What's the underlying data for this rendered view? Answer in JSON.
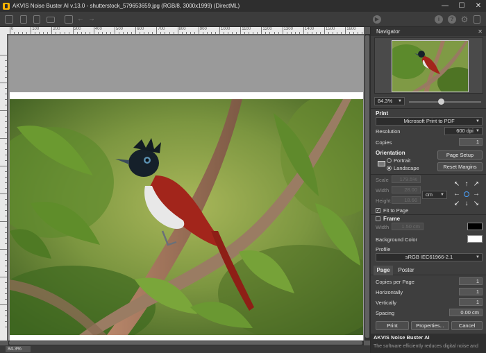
{
  "window": {
    "title": "AKVIS Noise Buster AI v.13.0 - shutterstock_579653659.jpg (RGB/8, 3000x1999) (DirectML)",
    "minimize": "—",
    "maximize": "☐",
    "close": "✕"
  },
  "toolbar": {
    "icons": [
      "open-icon",
      "save-icon",
      "batch-icon",
      "print-icon",
      "screen-icon",
      "undo-icon",
      "redo-icon",
      "run-icon",
      "info-icon",
      "help-icon",
      "settings-icon",
      "share-icon"
    ]
  },
  "ruler": {
    "top_labels": [
      "0",
      "100",
      "200",
      "300",
      "400",
      "500",
      "600",
      "700",
      "800",
      "900",
      "1000",
      "1100",
      "1200",
      "1300",
      "1400",
      "1500",
      "1600"
    ],
    "left_labels": [
      "100",
      "200",
      "300",
      "400",
      "500",
      "600",
      "700",
      "800",
      "900",
      "1000"
    ]
  },
  "status": {
    "zoom": "84.3%"
  },
  "navigator": {
    "title": "Navigator",
    "close": "✕",
    "zoom": "84.3%",
    "zoom_slider": 0.45
  },
  "print": {
    "heading": "Print",
    "printer": "Microsoft Print to PDF",
    "resolution_label": "Resolution",
    "resolution": "600 dpi",
    "copies_label": "Copies",
    "copies": "1",
    "orientation_label": "Orientation",
    "portrait": "Portrait",
    "landscape": "Landscape",
    "orientation_selected": "Landscape",
    "page_setup": "Page Setup",
    "reset_margins": "Reset Margins",
    "scale_label": "Scale",
    "scale": "179.5%",
    "width_label": "Width",
    "width": "28.00",
    "height_label": "Height",
    "height": "18.66",
    "unit": "cm",
    "fit_to_page": "Fit to Page",
    "fit_checked": true,
    "frame_label": "Frame",
    "frame_checked": false,
    "frame_width_label": "Width",
    "frame_width": "1.50 cm",
    "frame_color": "#000000",
    "background_color_label": "Background Color",
    "background_color": "#ffffff",
    "profile_label": "Profile",
    "profile": "sRGB IEC61966-2.1"
  },
  "tabs": {
    "page": "Page",
    "poster": "Poster",
    "active": "Page"
  },
  "page": {
    "copies_per_page_label": "Copies per Page",
    "copies_per_page": "1",
    "horizontally_label": "Horizontally",
    "horizontally": "1",
    "vertically_label": "Vertically",
    "vertically": "1",
    "spacing_label": "Spacing",
    "spacing": "0.00 cm"
  },
  "actions": {
    "print": "Print",
    "properties": "Properties...",
    "cancel": "Cancel"
  },
  "info": {
    "title": "AKVIS Noise Buster AI",
    "text": "The software efficiently reduces digital noise and"
  }
}
